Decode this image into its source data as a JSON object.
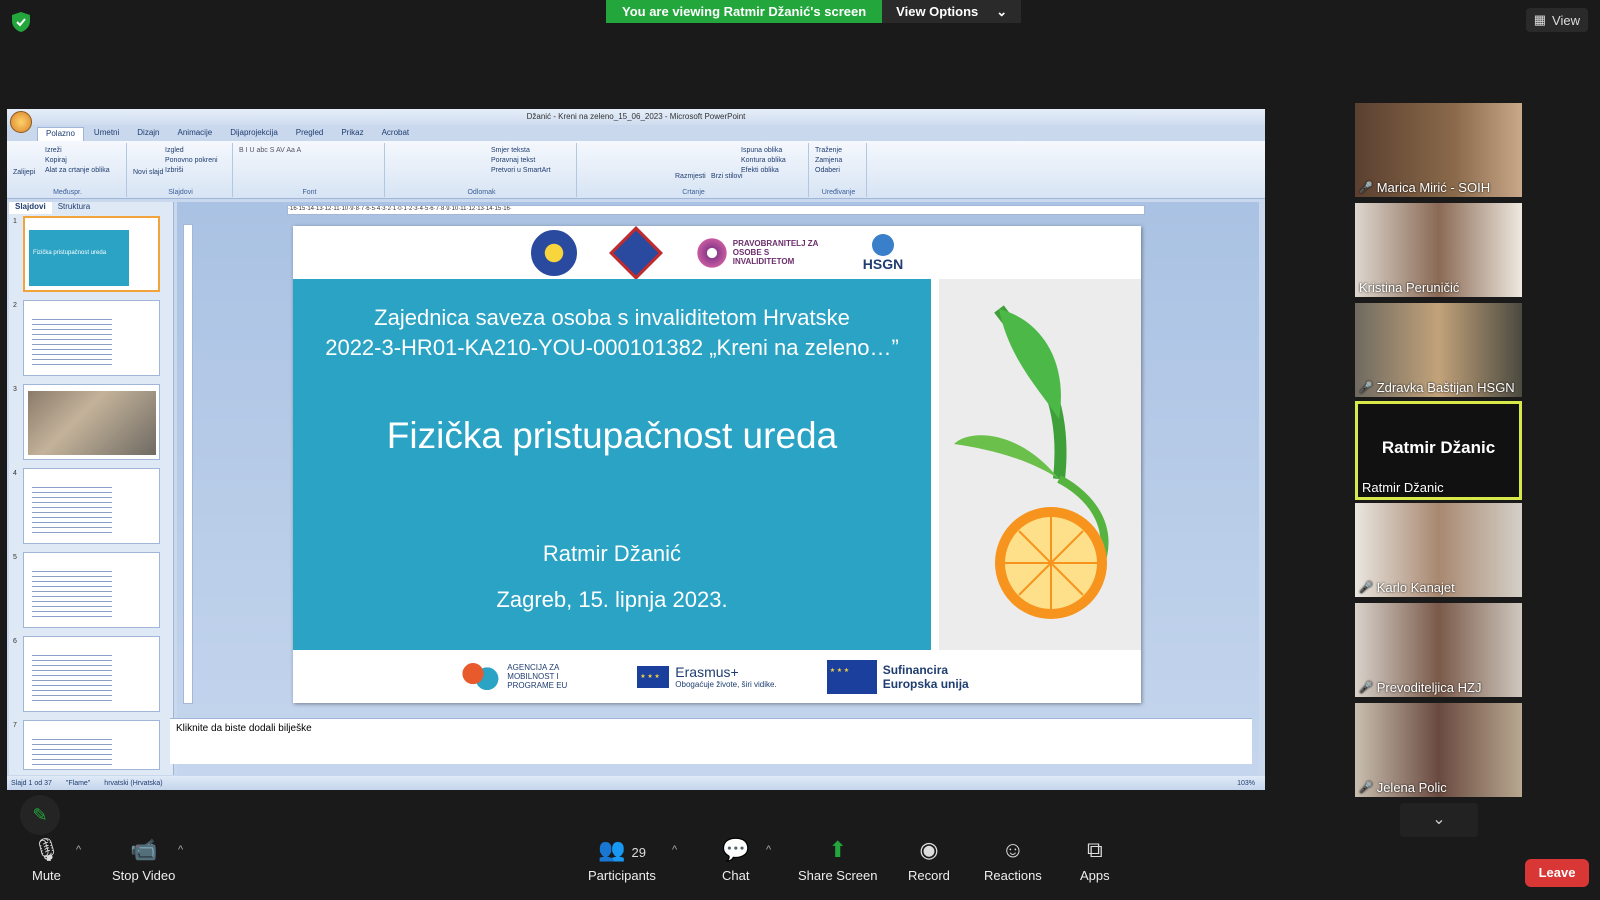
{
  "banner": {
    "viewing": "You are viewing Ratmir Džanić's screen",
    "view_options": "View Options",
    "view_button": "View"
  },
  "ppt": {
    "window_title": "Džanić - Kreni na zeleno_15_06_2023 - Microsoft PowerPoint",
    "tabs": [
      "Polazno",
      "Umetni",
      "Dizajn",
      "Animacije",
      "Dijaprojekcija",
      "Pregled",
      "Prikaz",
      "Acrobat"
    ],
    "ribbon_groups": [
      {
        "name": "Međuspr.",
        "items": [
          "Izreži",
          "Kopiraj",
          "Alat za crtanje oblika",
          "Zalijepi"
        ]
      },
      {
        "name": "Slajdovi",
        "items": [
          "Izgled",
          "Ponovno pokreni",
          "Izbriši",
          "Novi slajd"
        ]
      },
      {
        "name": "Font",
        "items": []
      },
      {
        "name": "Odlomak",
        "items": [
          "Smjer teksta",
          "Poravnaj tekst",
          "Pretvori u SmartArt"
        ]
      },
      {
        "name": "Crtanje",
        "items": [
          "Razmjesti",
          "Brzi stilovi",
          "Ispuna oblika",
          "Kontura oblika",
          "Efekti oblika"
        ]
      },
      {
        "name": "Uređivanje",
        "items": [
          "Traženje",
          "Zamjena",
          "Odaberi"
        ]
      }
    ],
    "side_tabs": [
      "Slajdovi",
      "Struktura"
    ],
    "slide": {
      "org_line1": "Zajednica saveza osoba s invaliditetom Hrvatske",
      "org_line2": "2022-3-HR01-KA210-YOU-000101382 „Kreni na zeleno…”",
      "title": "Fizička pristupačnost ureda",
      "author": "Ratmir Džanić",
      "date": "Zagreb, 15. lipnja 2023.",
      "logo_pravo": "PRAVOBRANITELJ ZA OSOBE S INVALIDITETOM",
      "logo_hsgn": "HSGN",
      "footer_agency": "AGENCIJA ZA MOBILNOST I PROGRAME EU",
      "footer_erasmus": "Erasmus+",
      "footer_erasmus_sub": "Obogaćuje živote, širi vidike.",
      "footer_cofund": "Sufinancira Europska unija"
    },
    "notes_placeholder": "Kliknite da biste dodali bilješke",
    "status": {
      "slide": "Slajd 1 od 37",
      "theme": "\"Flame\"",
      "language": "hrvatski (Hrvatska)",
      "zoom": "103%"
    }
  },
  "gallery": [
    {
      "name": "Marica Mirić - SOIH",
      "muted": true
    },
    {
      "name": "Kristina Peruničić",
      "muted": false
    },
    {
      "name": "Zdravka Baštijan HSGN",
      "muted": true
    },
    {
      "name": "Ratmir Džanic",
      "center": "Ratmir Džanic",
      "muted": false
    },
    {
      "name": "Karlo Kanajet",
      "muted": true
    },
    {
      "name": "Prevoditeljica HZJ",
      "muted": true
    },
    {
      "name": "Jelena Polic",
      "muted": true
    }
  ],
  "toolbar": {
    "mute": "Mute",
    "stop_video": "Stop Video",
    "participants": "Participants",
    "participants_count": "29",
    "chat": "Chat",
    "share_screen": "Share Screen",
    "record": "Record",
    "reactions": "Reactions",
    "apps": "Apps",
    "leave": "Leave"
  }
}
